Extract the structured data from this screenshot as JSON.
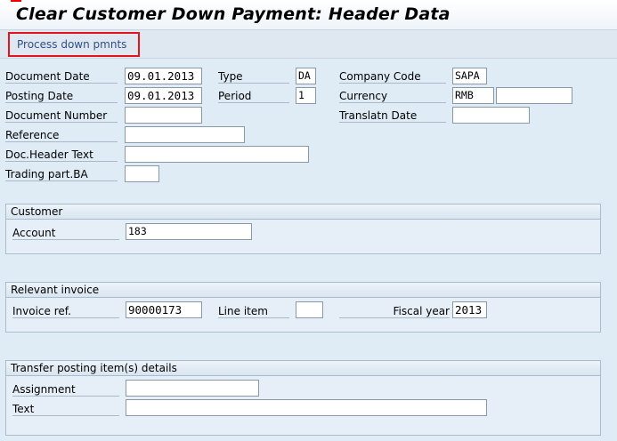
{
  "window": {
    "title": "Clear Customer Down Payment: Header Data"
  },
  "toolbar": {
    "process_button": "Process down pmnts"
  },
  "header": {
    "document_date_label": "Document Date",
    "document_date": "09.01.2013",
    "posting_date_label": "Posting Date",
    "posting_date": "09.01.2013",
    "document_number_label": "Document Number",
    "document_number": "",
    "reference_label": "Reference",
    "reference": "",
    "doc_header_text_label": "Doc.Header Text",
    "doc_header_text": "",
    "trading_part_label": "Trading part.BA",
    "trading_part": "",
    "type_label": "Type",
    "type": "DA",
    "period_label": "Period",
    "period": "1",
    "company_code_label": "Company Code",
    "company_code": "SAPA",
    "currency_label": "Currency",
    "currency": "RMB",
    "currency_rate": "",
    "translatn_date_label": "Translatn Date",
    "translatn_date": ""
  },
  "customer": {
    "title": "Customer",
    "account_label": "Account",
    "account": "183"
  },
  "invoice": {
    "title": "Relevant invoice",
    "invoice_ref_label": "Invoice ref.",
    "invoice_ref": "90000173",
    "line_item_label": "Line item",
    "line_item": "",
    "fiscal_year_label": "Fiscal year",
    "fiscal_year": "2013"
  },
  "transfer": {
    "title": "Transfer posting item(s) details",
    "assignment_label": "Assignment",
    "assignment": "",
    "text_label": "Text",
    "text": ""
  }
}
